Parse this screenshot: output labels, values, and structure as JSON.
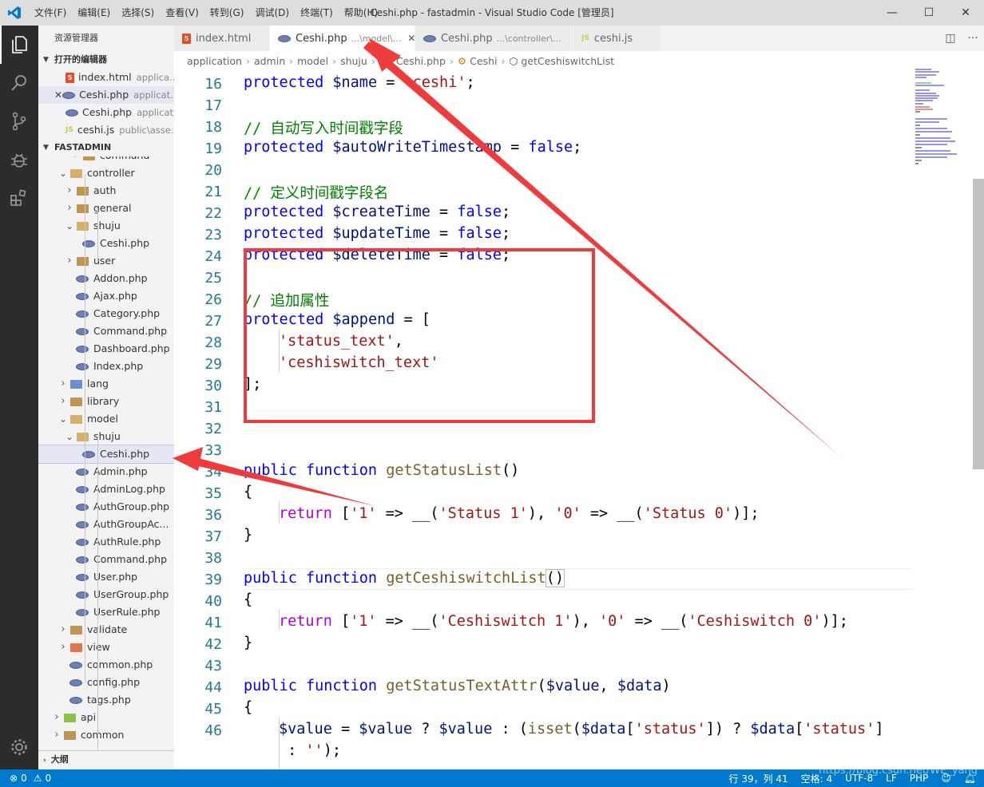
{
  "window": {
    "title": "Ceshi.php - fastadmin - Visual Studio Code [管理员]",
    "menu": [
      "文件(F)",
      "编辑(E)",
      "选择(S)",
      "查看(V)",
      "转到(G)",
      "调试(D)",
      "终端(T)",
      "帮助(H)"
    ]
  },
  "sidebar": {
    "title": "资源管理器",
    "open_editors_header": "打开的编辑器",
    "open_editors": [
      {
        "name": "index.html",
        "path": "applica...",
        "icon": "html-icon"
      },
      {
        "name": "Ceshi.php",
        "path": "applicat...",
        "icon": "php-icon"
      },
      {
        "name": "Ceshi.php",
        "path": "applicat...",
        "icon": "php-icon"
      },
      {
        "name": "ceshi.js",
        "path": "public\\asse...",
        "icon": "js-icon"
      }
    ],
    "workspace_header": "FASTADMIN",
    "tree": [
      {
        "label": "command",
        "type": "folder"
      },
      {
        "label": "controller",
        "type": "folder-open"
      },
      {
        "label": "auth",
        "type": "folder"
      },
      {
        "label": "general",
        "type": "folder"
      },
      {
        "label": "shuju",
        "type": "folder-open"
      },
      {
        "label": "Ceshi.php",
        "type": "php"
      },
      {
        "label": "user",
        "type": "folder"
      },
      {
        "label": "Addon.php",
        "type": "php"
      },
      {
        "label": "Ajax.php",
        "type": "php"
      },
      {
        "label": "Category.php",
        "type": "php"
      },
      {
        "label": "Command.php",
        "type": "php"
      },
      {
        "label": "Dashboard.php",
        "type": "php"
      },
      {
        "label": "Index.php",
        "type": "php"
      },
      {
        "label": "lang",
        "type": "folder"
      },
      {
        "label": "library",
        "type": "folder"
      },
      {
        "label": "model",
        "type": "folder-open"
      },
      {
        "label": "shuju",
        "type": "folder-open"
      },
      {
        "label": "Ceshi.php",
        "type": "php"
      },
      {
        "label": "Admin.php",
        "type": "php"
      },
      {
        "label": "AdminLog.php",
        "type": "php"
      },
      {
        "label": "AuthGroup.php",
        "type": "php"
      },
      {
        "label": "AuthGroupAc...",
        "type": "php"
      },
      {
        "label": "AuthRule.php",
        "type": "php"
      },
      {
        "label": "Command.php",
        "type": "php"
      },
      {
        "label": "User.php",
        "type": "php"
      },
      {
        "label": "UserGroup.php",
        "type": "php"
      },
      {
        "label": "UserRule.php",
        "type": "php"
      },
      {
        "label": "validate",
        "type": "folder"
      },
      {
        "label": "view",
        "type": "folder"
      },
      {
        "label": "common.php",
        "type": "php"
      },
      {
        "label": "config.php",
        "type": "php"
      },
      {
        "label": "tags.php",
        "type": "php"
      },
      {
        "label": "api",
        "type": "folder"
      },
      {
        "label": "common",
        "type": "folder"
      }
    ],
    "outline_header": "大纲"
  },
  "tabs": [
    {
      "name": "index.html",
      "desc": "",
      "icon": "html-icon"
    },
    {
      "name": "Ceshi.php",
      "desc": "...\\model\\...",
      "icon": "php-icon",
      "close": "✕"
    },
    {
      "name": "Ceshi.php",
      "desc": "...\\controller\\...",
      "icon": "php-icon"
    },
    {
      "name": "ceshi.js",
      "desc": "",
      "icon": "js-icon"
    }
  ],
  "breadcrumb": [
    "application",
    "admin",
    "model",
    "shuju",
    "Ceshi.php",
    "Ceshi",
    "getCeshiswitchList"
  ],
  "editor": {
    "line_numbers": [
      "16",
      "17",
      "18",
      "19",
      "20",
      "21",
      "22",
      "23",
      "24",
      "25",
      "26",
      "27",
      "28",
      "29",
      "30",
      "31",
      "32",
      "33",
      "34",
      "35",
      "36",
      "37",
      "38",
      "39",
      "40",
      "41",
      "42",
      "43",
      "44",
      "45",
      "46"
    ],
    "code": {
      "l16_kw": "protected",
      "l16_var": " $name",
      "l16_op": " = ",
      "l16_str": "'ceshi'",
      "l16_end": ";",
      "l18_cm": "// 自动写入时间戳字段",
      "l19_kw": "protected",
      "l19_var": " $autoWriteTimestamp",
      "l19_op": " = ",
      "l19_val": "false",
      "l19_end": ";",
      "l21_cm": "// 定义时间戳字段名",
      "l22_kw": "protected",
      "l22_var": " $createTime",
      "l22_op": " = ",
      "l22_val": "false",
      "l22_end": ";",
      "l23_kw": "protected",
      "l23_var": " $updateTime",
      "l23_op": " = ",
      "l23_val": "false",
      "l23_end": ";",
      "l24_kw": "protected",
      "l24_var": " $deleteTime",
      "l24_op": " = ",
      "l24_val": "false",
      "l24_end": ";",
      "l26_cm": "// 追加属性",
      "l27_kw": "protected",
      "l27_var": " $append",
      "l27_op": " = [",
      "l28_str": "'status_text'",
      "l28_end": ",",
      "l29_str": "'ceshiswitch_text'",
      "l30": "];",
      "l34_kw": "public function",
      "l34_fn": " getStatusList",
      "l34_end": "()",
      "l35": "{",
      "l36_ret": "return",
      "l36_a": " [",
      "l36_s1": "'1'",
      "l36_b": " => __(",
      "l36_s2": "'Status 1'",
      "l36_c": "), ",
      "l36_s3": "'0'",
      "l36_d": " => __(",
      "l36_s4": "'Status 0'",
      "l36_e": ")];",
      "l37": "}",
      "l39_kw": "public function",
      "l39_fn": " getCeshiswitchList",
      "l39_end": "()",
      "l40": "{",
      "l41_ret": "return",
      "l41_a": " [",
      "l41_s1": "'1'",
      "l41_b": " => __(",
      "l41_s2": "'Ceshiswitch 1'",
      "l41_c": "), ",
      "l41_s3": "'0'",
      "l41_d": " => __(",
      "l41_s4": "'Ceshiswitch 0'",
      "l41_e": ")];",
      "l42": "}",
      "l44_kw": "public function",
      "l44_fn": " getStatusTextAttr",
      "l44_a": "(",
      "l44_v1": "$value",
      "l44_b": ", ",
      "l44_v2": "$data",
      "l44_c": ")",
      "l45": "{",
      "l46_v1": "$value",
      "l46_a": " = ",
      "l46_v2": "$value",
      "l46_b": " ? ",
      "l46_v3": "$value",
      "l46_c": " : (",
      "l46_fn": "isset",
      "l46_d": "(",
      "l46_v4": "$data",
      "l46_e": "[",
      "l46_s1": "'status'",
      "l46_f": "]) ? ",
      "l46_v5": "$data",
      "l46_g": "[",
      "l46_s2": "'status'",
      "l46_h": "]",
      "l46_wrap_a": " : ",
      "l46_wrap_s": "''",
      "l46_wrap_b": ");"
    }
  },
  "statusbar": {
    "errors": "0",
    "warnings": "0",
    "position": "行 39，列 41",
    "spaces": "空格: 4",
    "encoding": "UTF-8",
    "eol": "LF",
    "language": "PHP",
    "watermark": "https://blog.csdn.net/WE_yang"
  },
  "colors": {
    "accent": "#007acc",
    "annotation_red": "#ee3b3b"
  }
}
